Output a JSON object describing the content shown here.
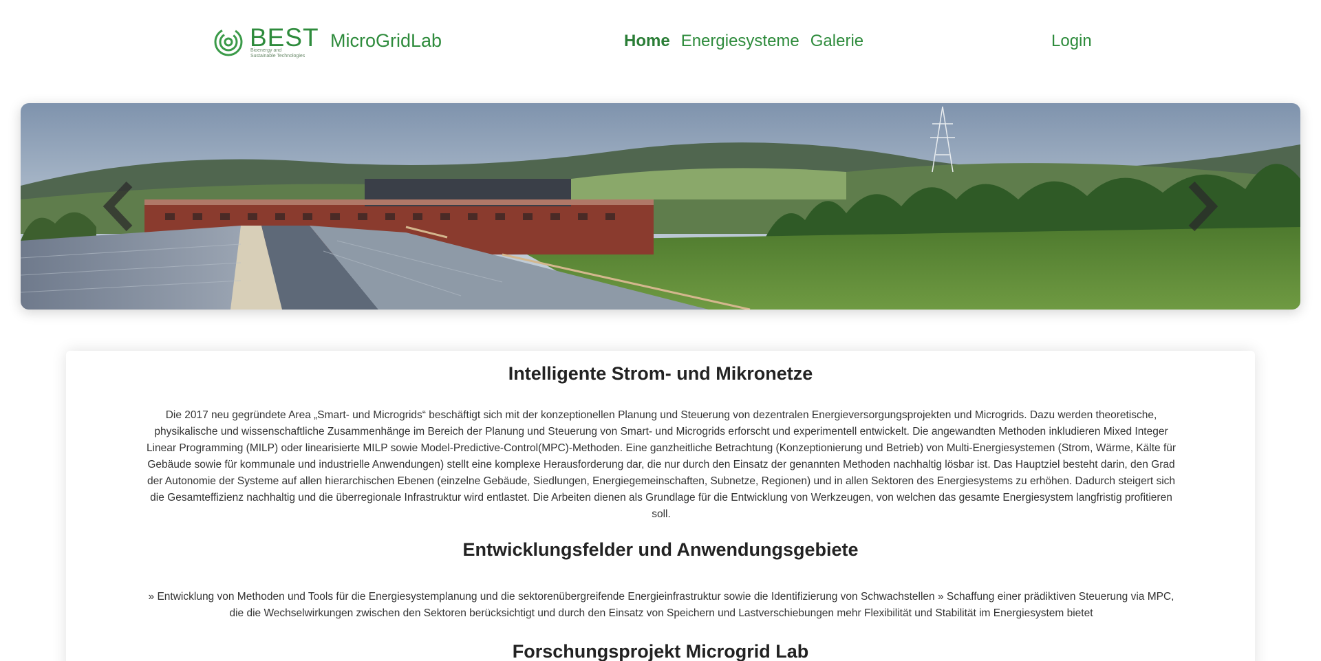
{
  "header": {
    "logo": {
      "wordmark": "BEST",
      "tagline_line1": "Bioenergy and",
      "tagline_line2": "Sustainable Technologies"
    },
    "brand_name": "MicroGridLab",
    "nav": [
      {
        "label": "Home",
        "active": true
      },
      {
        "label": "Energiesysteme",
        "active": false
      },
      {
        "label": "Galerie",
        "active": false
      }
    ],
    "login_label": "Login",
    "accent_color": "#2e8b3c"
  },
  "carousel": {
    "image_description_icon": "landscape-photo",
    "prev_icon": "chevron-left-icon",
    "next_icon": "chevron-right-icon"
  },
  "content": {
    "section1_title": "Intelligente Strom- und Mikronetze",
    "section1_text": "Die 2017 neu gegründete Area „Smart- und Microgrids“ beschäftigt sich mit der konzeptionellen Planung und Steuerung von dezentralen Energieversorgungsprojekten und Microgrids. Dazu werden theoretische, physikalische und wissenschaftliche Zusammenhänge im Bereich der Planung und Steuerung von Smart- und Microgrids erforscht und experimentell entwickelt. Die angewandten Methoden inkludieren Mixed Integer Linear Programming (MILP) oder linearisierte MILP sowie Model-Predictive-Control(MPC)-Methoden. Eine ganzheitliche Betrachtung (Konzeptionierung und Betrieb) von Multi-Energiesystemen (Strom, Wärme, Kälte für Gebäude sowie für kommunale und industrielle Anwendungen) stellt eine komplexe Herausforderung dar, die nur durch den Einsatz der genannten Methoden nachhaltig lösbar ist. Das Hauptziel besteht darin, den Grad der Autonomie der Systeme auf allen hierarchischen Ebenen (einzelne Gebäude, Siedlungen, Energiegemeinschaften, Subnetze, Regionen) und in allen Sektoren des Energiesystems zu erhöhen. Dadurch steigert sich die Gesamteffizienz nachhaltig und die überregionale Infrastruktur wird entlastet. Die Arbeiten dienen als Grundlage für die Entwicklung von Werkzeugen, von welchen das gesamte Energiesystem langfristig profitieren soll.",
    "section2_title": "Entwicklungsfelder und Anwendungsgebiete",
    "section2_text": "» Entwicklung von Methoden und Tools für die Energiesystemplanung und die sektorenübergreifende Energieinfrastruktur sowie die Identifizierung von Schwachstellen » Schaffung einer prädiktiven Steuerung via MPC, die die Wechselwirkungen zwischen den Sektoren berücksichtigt und durch den Einsatz von Speichern und Lastverschiebungen mehr Flexibilität und Stabilität im Energiesystem bietet",
    "section3_title": "Forschungsprojekt Microgrid Lab"
  }
}
